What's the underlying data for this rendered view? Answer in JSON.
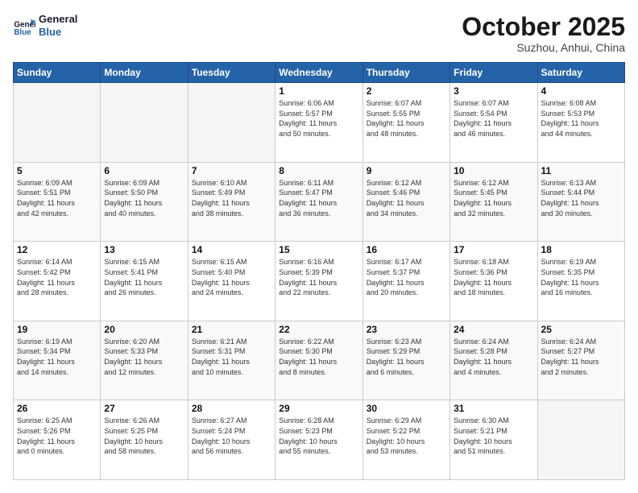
{
  "logo": {
    "line1": "General",
    "line2": "Blue"
  },
  "header": {
    "month": "October 2025",
    "location": "Suzhou, Anhui, China"
  },
  "weekdays": [
    "Sunday",
    "Monday",
    "Tuesday",
    "Wednesday",
    "Thursday",
    "Friday",
    "Saturday"
  ],
  "weeks": [
    [
      {
        "day": "",
        "info": ""
      },
      {
        "day": "",
        "info": ""
      },
      {
        "day": "",
        "info": ""
      },
      {
        "day": "1",
        "info": "Sunrise: 6:06 AM\nSunset: 5:57 PM\nDaylight: 11 hours\nand 50 minutes."
      },
      {
        "day": "2",
        "info": "Sunrise: 6:07 AM\nSunset: 5:55 PM\nDaylight: 11 hours\nand 48 minutes."
      },
      {
        "day": "3",
        "info": "Sunrise: 6:07 AM\nSunset: 5:54 PM\nDaylight: 11 hours\nand 46 minutes."
      },
      {
        "day": "4",
        "info": "Sunrise: 6:08 AM\nSunset: 5:53 PM\nDaylight: 11 hours\nand 44 minutes."
      }
    ],
    [
      {
        "day": "5",
        "info": "Sunrise: 6:09 AM\nSunset: 5:51 PM\nDaylight: 11 hours\nand 42 minutes."
      },
      {
        "day": "6",
        "info": "Sunrise: 6:09 AM\nSunset: 5:50 PM\nDaylight: 11 hours\nand 40 minutes."
      },
      {
        "day": "7",
        "info": "Sunrise: 6:10 AM\nSunset: 5:49 PM\nDaylight: 11 hours\nand 38 minutes."
      },
      {
        "day": "8",
        "info": "Sunrise: 6:11 AM\nSunset: 5:47 PM\nDaylight: 11 hours\nand 36 minutes."
      },
      {
        "day": "9",
        "info": "Sunrise: 6:12 AM\nSunset: 5:46 PM\nDaylight: 11 hours\nand 34 minutes."
      },
      {
        "day": "10",
        "info": "Sunrise: 6:12 AM\nSunset: 5:45 PM\nDaylight: 11 hours\nand 32 minutes."
      },
      {
        "day": "11",
        "info": "Sunrise: 6:13 AM\nSunset: 5:44 PM\nDaylight: 11 hours\nand 30 minutes."
      }
    ],
    [
      {
        "day": "12",
        "info": "Sunrise: 6:14 AM\nSunset: 5:42 PM\nDaylight: 11 hours\nand 28 minutes."
      },
      {
        "day": "13",
        "info": "Sunrise: 6:15 AM\nSunset: 5:41 PM\nDaylight: 11 hours\nand 26 minutes."
      },
      {
        "day": "14",
        "info": "Sunrise: 6:15 AM\nSunset: 5:40 PM\nDaylight: 11 hours\nand 24 minutes."
      },
      {
        "day": "15",
        "info": "Sunrise: 6:16 AM\nSunset: 5:39 PM\nDaylight: 11 hours\nand 22 minutes."
      },
      {
        "day": "16",
        "info": "Sunrise: 6:17 AM\nSunset: 5:37 PM\nDaylight: 11 hours\nand 20 minutes."
      },
      {
        "day": "17",
        "info": "Sunrise: 6:18 AM\nSunset: 5:36 PM\nDaylight: 11 hours\nand 18 minutes."
      },
      {
        "day": "18",
        "info": "Sunrise: 6:19 AM\nSunset: 5:35 PM\nDaylight: 11 hours\nand 16 minutes."
      }
    ],
    [
      {
        "day": "19",
        "info": "Sunrise: 6:19 AM\nSunset: 5:34 PM\nDaylight: 11 hours\nand 14 minutes."
      },
      {
        "day": "20",
        "info": "Sunrise: 6:20 AM\nSunset: 5:33 PM\nDaylight: 11 hours\nand 12 minutes."
      },
      {
        "day": "21",
        "info": "Sunrise: 6:21 AM\nSunset: 5:31 PM\nDaylight: 11 hours\nand 10 minutes."
      },
      {
        "day": "22",
        "info": "Sunrise: 6:22 AM\nSunset: 5:30 PM\nDaylight: 11 hours\nand 8 minutes."
      },
      {
        "day": "23",
        "info": "Sunrise: 6:23 AM\nSunset: 5:29 PM\nDaylight: 11 hours\nand 6 minutes."
      },
      {
        "day": "24",
        "info": "Sunrise: 6:24 AM\nSunset: 5:28 PM\nDaylight: 11 hours\nand 4 minutes."
      },
      {
        "day": "25",
        "info": "Sunrise: 6:24 AM\nSunset: 5:27 PM\nDaylight: 11 hours\nand 2 minutes."
      }
    ],
    [
      {
        "day": "26",
        "info": "Sunrise: 6:25 AM\nSunset: 5:26 PM\nDaylight: 11 hours\nand 0 minutes."
      },
      {
        "day": "27",
        "info": "Sunrise: 6:26 AM\nSunset: 5:25 PM\nDaylight: 10 hours\nand 58 minutes."
      },
      {
        "day": "28",
        "info": "Sunrise: 6:27 AM\nSunset: 5:24 PM\nDaylight: 10 hours\nand 56 minutes."
      },
      {
        "day": "29",
        "info": "Sunrise: 6:28 AM\nSunset: 5:23 PM\nDaylight: 10 hours\nand 55 minutes."
      },
      {
        "day": "30",
        "info": "Sunrise: 6:29 AM\nSunset: 5:22 PM\nDaylight: 10 hours\nand 53 minutes."
      },
      {
        "day": "31",
        "info": "Sunrise: 6:30 AM\nSunset: 5:21 PM\nDaylight: 10 hours\nand 51 minutes."
      },
      {
        "day": "",
        "info": ""
      }
    ]
  ]
}
